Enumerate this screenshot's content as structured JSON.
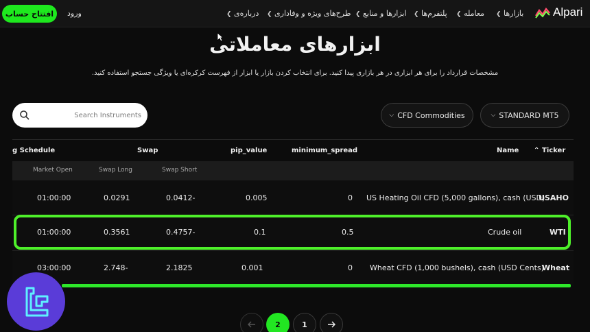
{
  "nav": {
    "cta_label": "افتتاح حساب",
    "login_label": "ورود",
    "menu": [
      {
        "label": "درباره‌ی"
      },
      {
        "label": "طرح‌های ویژه و وفاداری"
      },
      {
        "label": "ابزارها و منابع"
      },
      {
        "label": "پلتفرم‌ها"
      },
      {
        "label": "معامله"
      },
      {
        "label": "بازارها"
      }
    ],
    "logo_text": "Alpari"
  },
  "header": {
    "title": "ابزارهای معاملاتی",
    "subtitle": "مشخصات قرارداد را برای هر ابزاری در هر بازاری پیدا کنید. برای انتخاب کردن بازار یا ابزار از فهرست کرکره‌ای یا ویژگی جستجو استفاده کنید."
  },
  "controls": {
    "search_placeholder": "Search Instruments",
    "category_dropdown": "CFD Commodities",
    "account_dropdown": "STANDARD MT5"
  },
  "table": {
    "columns": {
      "schedule": "g Schedule",
      "swap": "Swap",
      "pip_value": "pip_value",
      "minimum_spread": "minimum_spread",
      "name": "Name",
      "ticker": "Ticker"
    },
    "subcolumns": {
      "market_open": "Market Open",
      "swap_long": "Swap Long",
      "swap_short": "Swap Short"
    },
    "rows": [
      {
        "market_open": "01:00:00",
        "swap_long": "0.0291",
        "swap_short": "0.0412-",
        "pip_value": "0.005",
        "minimum_spread": "0",
        "name": "US Heating Oil CFD (5,000 gallons), cash (USD)",
        "ticker": "USAHO"
      },
      {
        "market_open": "01:00:00",
        "swap_long": "0.3561",
        "swap_short": "0.4757-",
        "pip_value": "0.1",
        "minimum_spread": "0.5",
        "name": "Crude oil",
        "ticker": "WTI"
      },
      {
        "market_open": "03:00:00",
        "swap_long": "2.748-",
        "swap_short": "2.1825",
        "pip_value": "0.001",
        "minimum_spread": "0",
        "name": "Wheat CFD (1,000 bushels), cash (USD Cents)",
        "ticker": "Wheat"
      }
    ]
  },
  "pagination": {
    "active": "2",
    "page_1": "1"
  },
  "colors": {
    "accent_green": "#1ee81e",
    "badge_purple": "#5a3cd8"
  }
}
